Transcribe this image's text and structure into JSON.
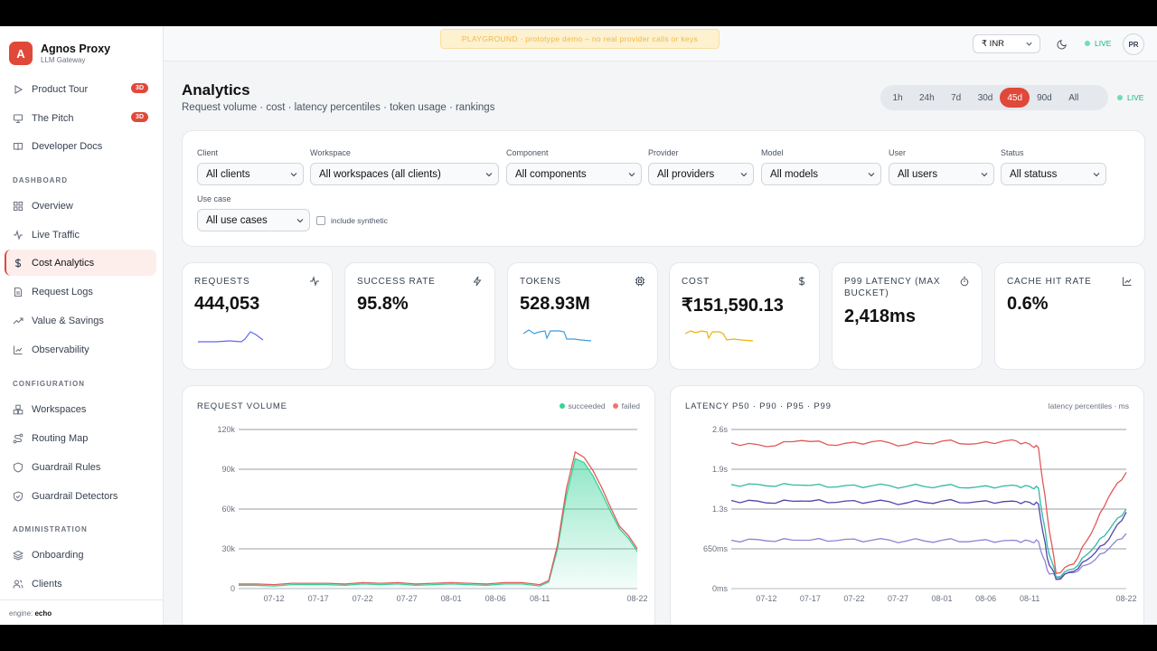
{
  "sidebar": {
    "brand": {
      "logo": "A",
      "name": "Agnos Proxy",
      "subtitle": "LLM Gateway"
    },
    "top_items": [
      {
        "label": "Product Tour",
        "icon": "play-icon",
        "badge": "3D"
      },
      {
        "label": "The Pitch",
        "icon": "monitor-icon",
        "badge": "3D"
      },
      {
        "label": "Developer Docs",
        "icon": "book-icon"
      }
    ],
    "sections": {
      "dashboard": "DASHBOARD",
      "configuration": "CONFIGURATION",
      "administration": "ADMINISTRATION"
    },
    "dashboard_items": [
      {
        "label": "Overview",
        "icon": "grid-icon"
      },
      {
        "label": "Live Traffic",
        "icon": "activity-icon"
      },
      {
        "label": "Cost Analytics",
        "icon": "dollar-icon",
        "active": true
      },
      {
        "label": "Request Logs",
        "icon": "file-icon"
      },
      {
        "label": "Value & Savings",
        "icon": "trend-up-icon"
      },
      {
        "label": "Observability",
        "icon": "line-chart-icon"
      }
    ],
    "configuration_items": [
      {
        "label": "Workspaces",
        "icon": "boxes-icon"
      },
      {
        "label": "Routing Map",
        "icon": "route-icon"
      },
      {
        "label": "Guardrail Rules",
        "icon": "shield-icon"
      },
      {
        "label": "Guardrail Detectors",
        "icon": "shield-check-icon"
      }
    ],
    "administration_items": [
      {
        "label": "Onboarding",
        "icon": "layers-icon"
      },
      {
        "label": "Clients",
        "icon": "users-icon"
      }
    ],
    "engine": {
      "label": "engine:",
      "value": "echo"
    }
  },
  "topbar": {
    "banner": "PLAYGROUND · prototype demo – no real provider calls or keys",
    "currency": "₹ INR",
    "live": "LIVE",
    "avatar": "PR"
  },
  "page": {
    "title": "Analytics",
    "subtitle": "Request volume · cost · latency percentiles · token usage · rankings",
    "ranges": [
      "1h",
      "24h",
      "7d",
      "30d",
      "45d",
      "90d",
      "All"
    ],
    "selected_range": "45d",
    "live": "LIVE"
  },
  "filters": {
    "client": {
      "label": "Client",
      "value": "All clients"
    },
    "workspace": {
      "label": "Workspace",
      "value": "All workspaces (all clients)"
    },
    "component": {
      "label": "Component",
      "value": "All components"
    },
    "provider": {
      "label": "Provider",
      "value": "All providers"
    },
    "model": {
      "label": "Model",
      "value": "All models"
    },
    "user": {
      "label": "User",
      "value": "All users"
    },
    "status": {
      "label": "Status",
      "value": "All statuss"
    },
    "use_case": {
      "label": "Use case",
      "value": "All use cases"
    },
    "synthetic": {
      "label": "include synthetic",
      "checked": false
    }
  },
  "kpis": [
    {
      "label": "REQUESTS",
      "value": "444,053",
      "icon": "activity-icon",
      "spark_color": "#6366f1"
    },
    {
      "label": "SUCCESS RATE",
      "value": "95.8%",
      "icon": "zap-icon"
    },
    {
      "label": "TOKENS",
      "value": "528.93M",
      "icon": "cpu-icon",
      "spark_color": "#3b9ede"
    },
    {
      "label": "COST",
      "value": "₹151,590.13",
      "icon": "dollar-icon",
      "spark_color": "#eab308"
    },
    {
      "label": "P99 LATENCY (MAX BUCKET)",
      "value": "2,418ms",
      "icon": "timer-icon"
    },
    {
      "label": "CACHE HIT RATE",
      "value": "0.6%",
      "icon": "bar-chart-icon"
    }
  ],
  "colors": {
    "accent": "#e0483a",
    "success": "#34d399",
    "failed": "#f87171",
    "live": "#10b981"
  },
  "chart_data": [
    {
      "type": "area",
      "title": "REQUEST VOLUME",
      "ylim": [
        0,
        120000
      ],
      "yticks": [
        "0",
        "30k",
        "60k",
        "90k",
        "120k"
      ],
      "xticks": [
        "07-12",
        "07-17",
        "07-22",
        "07-27",
        "08-01",
        "08-06",
        "08-11",
        "08-22"
      ],
      "legend": [
        {
          "name": "succeeded",
          "color": "#34d399"
        },
        {
          "name": "failed",
          "color": "#f87171"
        }
      ],
      "x": [
        "07-08",
        "07-10",
        "07-12",
        "07-14",
        "07-16",
        "07-18",
        "07-20",
        "07-22",
        "07-24",
        "07-26",
        "07-28",
        "07-30",
        "08-01",
        "08-03",
        "08-05",
        "08-07",
        "08-09",
        "08-11",
        "08-12",
        "08-13",
        "08-14",
        "08-15",
        "08-16",
        "08-17",
        "08-18",
        "08-19",
        "08-20",
        "08-21",
        "08-22"
      ],
      "series": [
        {
          "name": "succeeded",
          "values": [
            2500,
            2500,
            2000,
            3000,
            3000,
            3000,
            2500,
            3500,
            3000,
            3500,
            2500,
            3000,
            3500,
            3000,
            2500,
            3500,
            3500,
            2000,
            5000,
            30000,
            70000,
            98000,
            95000,
            85000,
            72000,
            58000,
            45000,
            38000,
            28000
          ]
        },
        {
          "name": "failed",
          "values": [
            3500,
            3500,
            3000,
            4000,
            4000,
            4000,
            3500,
            4500,
            4000,
            4500,
            3500,
            4000,
            4500,
            4000,
            3500,
            4500,
            4500,
            3000,
            6000,
            33000,
            75000,
            103000,
            99000,
            89000,
            76000,
            61000,
            47000,
            40000,
            30000
          ]
        }
      ]
    },
    {
      "type": "line",
      "title": "LATENCY P50 · P90 · P95 · P99",
      "note": "latency percentiles · ms",
      "ylim": [
        0,
        2600
      ],
      "yticks": [
        "0ms",
        "650ms",
        "1.3s",
        "1.9s",
        "2.6s"
      ],
      "xticks": [
        "07-12",
        "07-17",
        "07-22",
        "07-27",
        "08-01",
        "08-06",
        "08-11",
        "08-22"
      ],
      "x": [
        "07-08",
        "07-12",
        "07-16",
        "07-20",
        "07-24",
        "07-28",
        "08-01",
        "08-05",
        "08-09",
        "08-11",
        "08-12",
        "08-13",
        "08-14",
        "08-16",
        "08-18",
        "08-20",
        "08-22"
      ],
      "series": [
        {
          "name": "p50",
          "color": "#8b84d6",
          "values": [
            790,
            780,
            790,
            785,
            790,
            780,
            790,
            785,
            790,
            780,
            770,
            300,
            180,
            260,
            420,
            650,
            900
          ]
        },
        {
          "name": "p90",
          "color": "#4f46a8",
          "values": [
            1440,
            1400,
            1430,
            1410,
            1420,
            1400,
            1430,
            1420,
            1430,
            1410,
            1380,
            500,
            150,
            280,
            520,
            800,
            1250
          ]
        },
        {
          "name": "p95",
          "color": "#2fb9a2",
          "values": [
            1700,
            1680,
            1690,
            1660,
            1680,
            1670,
            1680,
            1660,
            1690,
            1670,
            1640,
            700,
            190,
            320,
            620,
            950,
            1300
          ]
        },
        {
          "name": "p99",
          "color": "#e05a57",
          "values": [
            2380,
            2320,
            2420,
            2340,
            2400,
            2350,
            2410,
            2370,
            2430,
            2360,
            2300,
            1200,
            250,
            400,
            900,
            1500,
            1900
          ]
        }
      ]
    }
  ]
}
